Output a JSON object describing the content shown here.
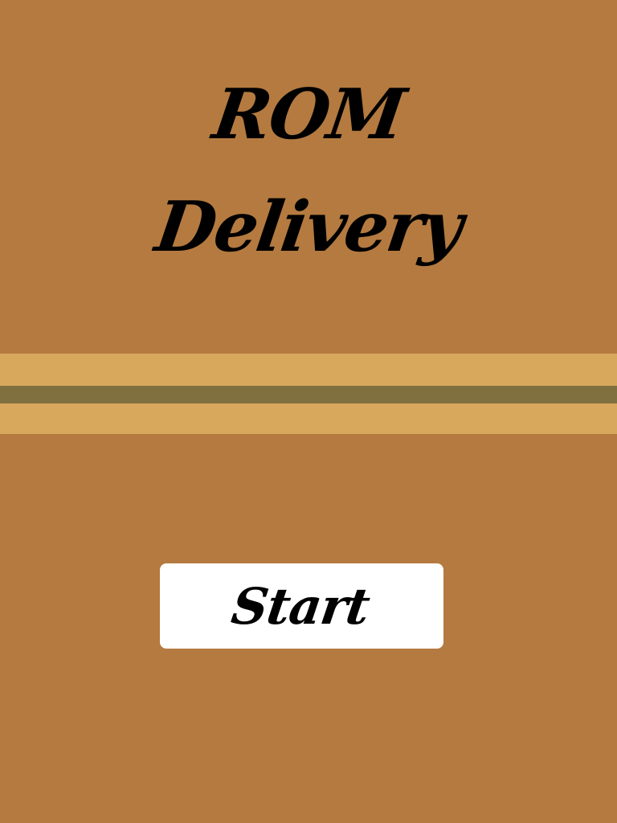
{
  "title": {
    "line1": "ROM",
    "line2": "Delivery"
  },
  "start_button": {
    "label": "Start"
  },
  "colors": {
    "background": "#B47A40",
    "stripe_light": "#D8A85C",
    "stripe_dark": "#807040",
    "button_bg": "#FFFFFF",
    "text": "#000000"
  }
}
